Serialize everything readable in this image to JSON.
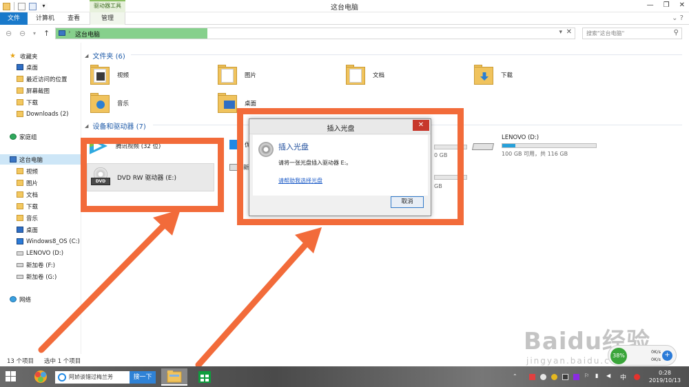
{
  "window": {
    "title": "这台电脑",
    "contextual_tab_header": "驱动器工具"
  },
  "ribbon": {
    "tabs": [
      {
        "label": "文件"
      },
      {
        "label": "计算机"
      },
      {
        "label": "查看"
      },
      {
        "label": "管理"
      }
    ]
  },
  "address": {
    "path": "这台电脑",
    "search_placeholder": "搜索\"这台电脑\""
  },
  "sidebar": {
    "favorites": {
      "label": "收藏夹",
      "items": [
        "桌面",
        "最近访问的位置",
        "屏幕截图",
        "下载",
        "Downloads (2)"
      ]
    },
    "homegroup": "家庭组",
    "this_pc": {
      "label": "这台电脑",
      "items": [
        "视频",
        "图片",
        "文档",
        "下载",
        "音乐",
        "桌面",
        "Windows8_OS (C:)",
        "LENOVO (D:)",
        "新加卷 (F:)",
        "新加卷 (G:)"
      ]
    },
    "network": "网络"
  },
  "main": {
    "folders_header": "文件夹 (6)",
    "folders": [
      "视频",
      "图片",
      "文档",
      "下载",
      "音乐",
      "桌面"
    ],
    "devices_header": "设备和驱动器 (7)",
    "tencent_video": "腾讯视频 (32 位)",
    "dvd_drive": "DVD RW 驱动器 (E:)",
    "lenovo_drive": {
      "name": "LENOVO (D:)",
      "space": "100 GB 可用，共 116 GB",
      "used_fraction": 0.14
    },
    "partial_drive_1": {
      "prefix": "优",
      "space_tail": "0 GB",
      "used_fraction": 0.1
    },
    "partial_drive_2": {
      "prefix": "新",
      "space_tail": "GB",
      "used_fraction": 0.05
    }
  },
  "status": {
    "count": "13 个项目",
    "selected": "选中 1 个项目"
  },
  "dialog": {
    "title": "插入光盘",
    "heading": "插入光盘",
    "message": "请将一张光盘插入驱动器 E:。",
    "help_link": "请帮助我选择光盘",
    "cancel_label": "取消"
  },
  "taskbar": {
    "search_text": "阿娇谈错过梅兰芳",
    "search_button": "搜一下",
    "ime": "中",
    "time": "0:28",
    "date": "2019/10/13"
  },
  "net_widget": {
    "percent": "38%",
    "up": "0K/s",
    "down": "0K/s"
  },
  "watermark": {
    "main": "Baidu经验",
    "sub": "jingyan.baidu.com"
  }
}
